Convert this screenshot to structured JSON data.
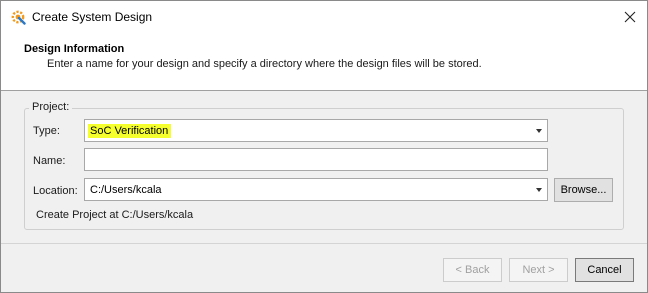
{
  "window": {
    "title": "Create System Design",
    "icon": "gear-wrench-icon"
  },
  "header": {
    "title": "Design Information",
    "description": "Enter a name for your design and specify a directory where the design files will be stored."
  },
  "project": {
    "legend": "Project:",
    "type_label": "Type:",
    "type_value": "SoC Verification",
    "name_label": "Name:",
    "name_value": "",
    "location_label": "Location:",
    "location_value": "C:/Users/kcala",
    "browse_label": "Browse...",
    "create_at_text": "Create Project at C:/Users/kcala"
  },
  "footer": {
    "back_label": "< Back",
    "next_label": "Next >",
    "cancel_label": "Cancel"
  },
  "colors": {
    "highlight": "#f5ff2e",
    "icon_orange": "#f29a1e",
    "icon_blue": "#2a79c9"
  }
}
